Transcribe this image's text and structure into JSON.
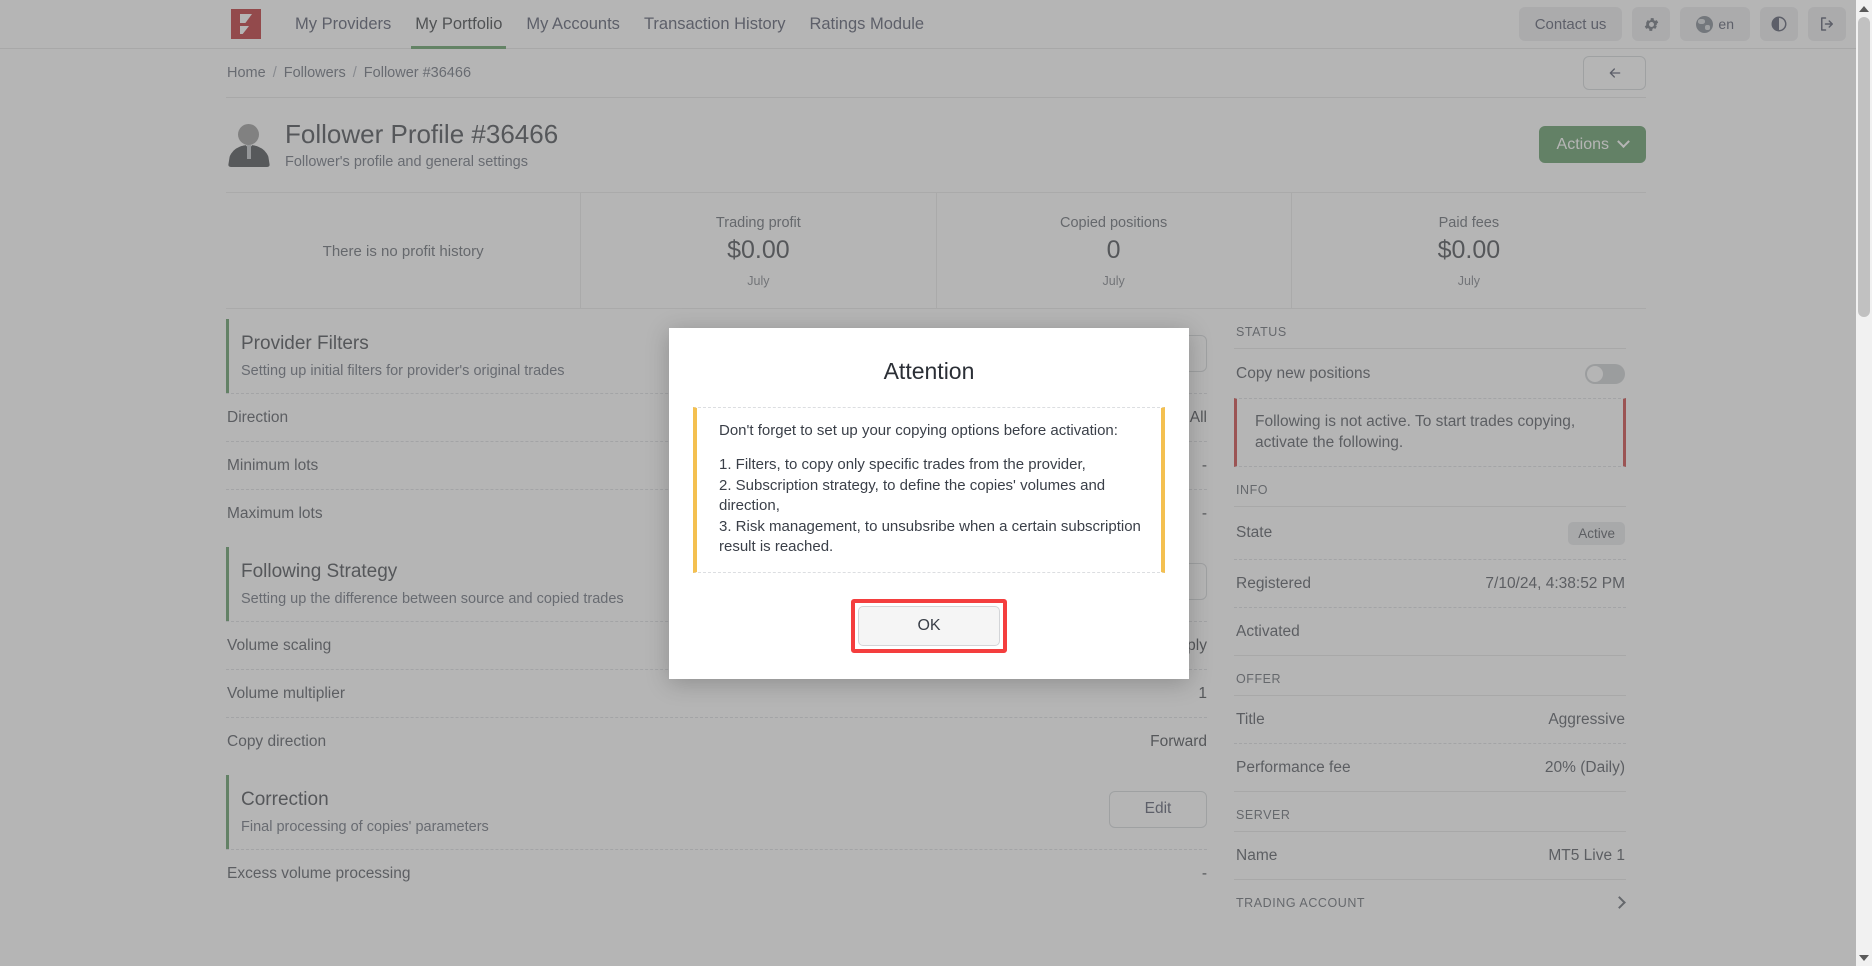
{
  "nav": {
    "logo": "brand-logo",
    "items": [
      {
        "label": "My Providers",
        "active": false
      },
      {
        "label": "My Portfolio",
        "active": true
      },
      {
        "label": "My Accounts",
        "active": false
      },
      {
        "label": "Transaction History",
        "active": false
      },
      {
        "label": "Ratings Module",
        "active": false
      }
    ],
    "contact_label": "Contact us",
    "lang": "en",
    "accent_green": "#4b8c50",
    "brand_red": "#b31217"
  },
  "breadcrumb": {
    "home": "Home",
    "followers": "Followers",
    "current": "Follower #36466",
    "sep": "/"
  },
  "profile": {
    "title": "Follower Profile #36466",
    "subtitle": "Follower's profile and general settings",
    "actions_label": "Actions"
  },
  "stats": {
    "empty_text": "There is no profit history",
    "cards": [
      {
        "label": "Trading profit",
        "value": "$0.00",
        "period": "July"
      },
      {
        "label": "Copied positions",
        "value": "0",
        "period": "July"
      },
      {
        "label": "Paid fees",
        "value": "$0.00",
        "period": "July"
      }
    ]
  },
  "sections": {
    "provider_filters": {
      "title": "Provider Filters",
      "desc": "Setting up initial filters for provider's original trades",
      "rows": [
        {
          "key": "Direction",
          "value": "All"
        },
        {
          "key": "Minimum lots",
          "value": "-"
        },
        {
          "key": "Maximum lots",
          "value": "-"
        }
      ]
    },
    "following_strategy": {
      "title": "Following Strategy",
      "desc": "Setting up the difference between source and copied trades",
      "rows": [
        {
          "key": "Volume scaling",
          "value": "Multiply"
        },
        {
          "key": "Volume multiplier",
          "value": "1"
        },
        {
          "key": "Copy direction",
          "value": "Forward"
        }
      ]
    },
    "correction": {
      "title": "Correction",
      "desc": "Final processing of copies' parameters",
      "edit_label": "Edit",
      "rows": [
        {
          "key": "Excess volume processing",
          "value": "-"
        }
      ]
    }
  },
  "aside": {
    "status_group": "STATUS",
    "copy_new_positions_label": "Copy new positions",
    "copy_new_positions_on": false,
    "alert": "Following is not active. To start trades copying, activate the following.",
    "alert_color": "#c62828",
    "info_group": "INFO",
    "info_rows": [
      {
        "key": "State",
        "value": "Active",
        "badge": true
      },
      {
        "key": "Registered",
        "value": "7/10/24, 4:38:52 PM",
        "badge": false
      },
      {
        "key": "Activated",
        "value": "",
        "badge": false
      }
    ],
    "offer_group": "OFFER",
    "offer_rows": [
      {
        "key": "Title",
        "value": "Aggressive"
      },
      {
        "key": "Performance fee",
        "value": "20% (Daily)"
      }
    ],
    "server_group": "SERVER",
    "server_rows": [
      {
        "key": "Name",
        "value": "MT5 Live 1"
      }
    ],
    "trading_account_group": "TRADING ACCOUNT"
  },
  "modal": {
    "title": "Attention",
    "intro": "Don't forget to set up your copying options before activation:",
    "items_text": "1. Filters, to copy only specific trades from the provider,\n2. Subscription strategy, to define the copies' volumes and direction,\n3. Risk management, to unsubsribe when a certain subscription result is reached.",
    "ok_label": "OK",
    "accent_color": "#f4c050",
    "highlight_color": "#f43e3e"
  }
}
